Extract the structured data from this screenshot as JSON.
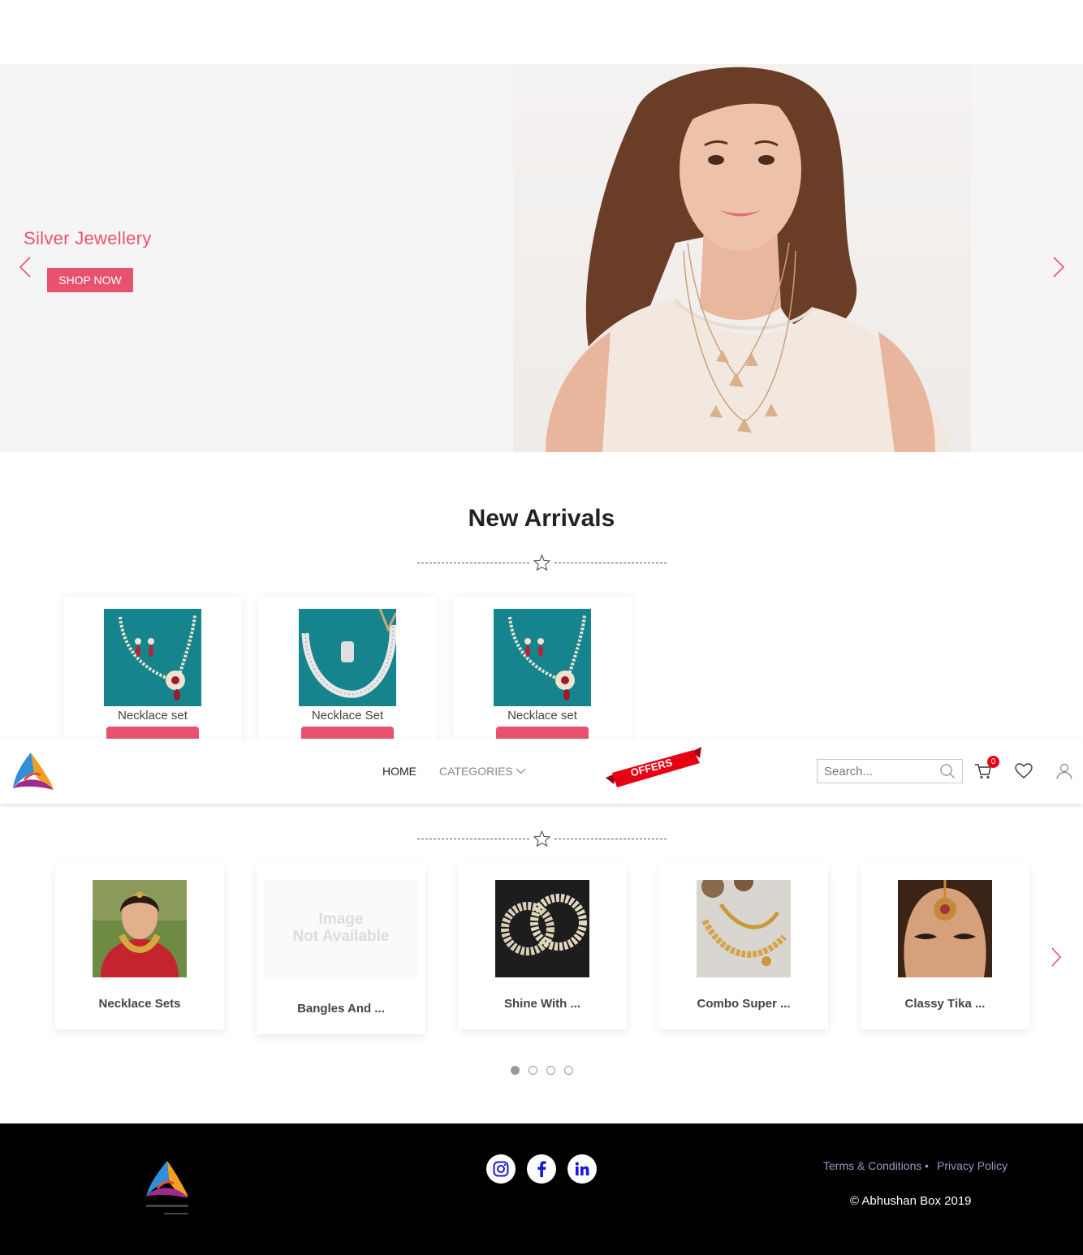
{
  "hero": {
    "title": "Silver Jewellery",
    "button": "SHOP NOW"
  },
  "new_arrivals": {
    "title": "New Arrivals",
    "products": [
      {
        "name": "Necklace set"
      },
      {
        "name": "Necklace Set"
      },
      {
        "name": "Necklace set"
      }
    ]
  },
  "nav": {
    "home": "HOME",
    "categories": "CATEGORIES",
    "offers": "OFFERS",
    "search_placeholder": "Search...",
    "cart_count": "0"
  },
  "categories": {
    "placeholder_line1": "Image",
    "placeholder_line2": "Not Available",
    "items": [
      {
        "name": "Necklace Sets"
      },
      {
        "name": "Bangles And ..."
      },
      {
        "name": "Shine With ..."
      },
      {
        "name": "Combo Super ..."
      },
      {
        "name": "Classy Tika ..."
      }
    ],
    "pages": 4,
    "active_page": 1
  },
  "footer": {
    "terms": "Terms & Conditions",
    "privacy": "Privacy Policy",
    "copyright": "© Abhushan Box 2019",
    "social": [
      "instagram-icon",
      "facebook-icon",
      "linkedin-icon"
    ]
  },
  "colors": {
    "accent": "#e8526e",
    "offer_red": "#e60012",
    "footer_bg": "#000000",
    "social_icon": "#1a1ad6"
  }
}
